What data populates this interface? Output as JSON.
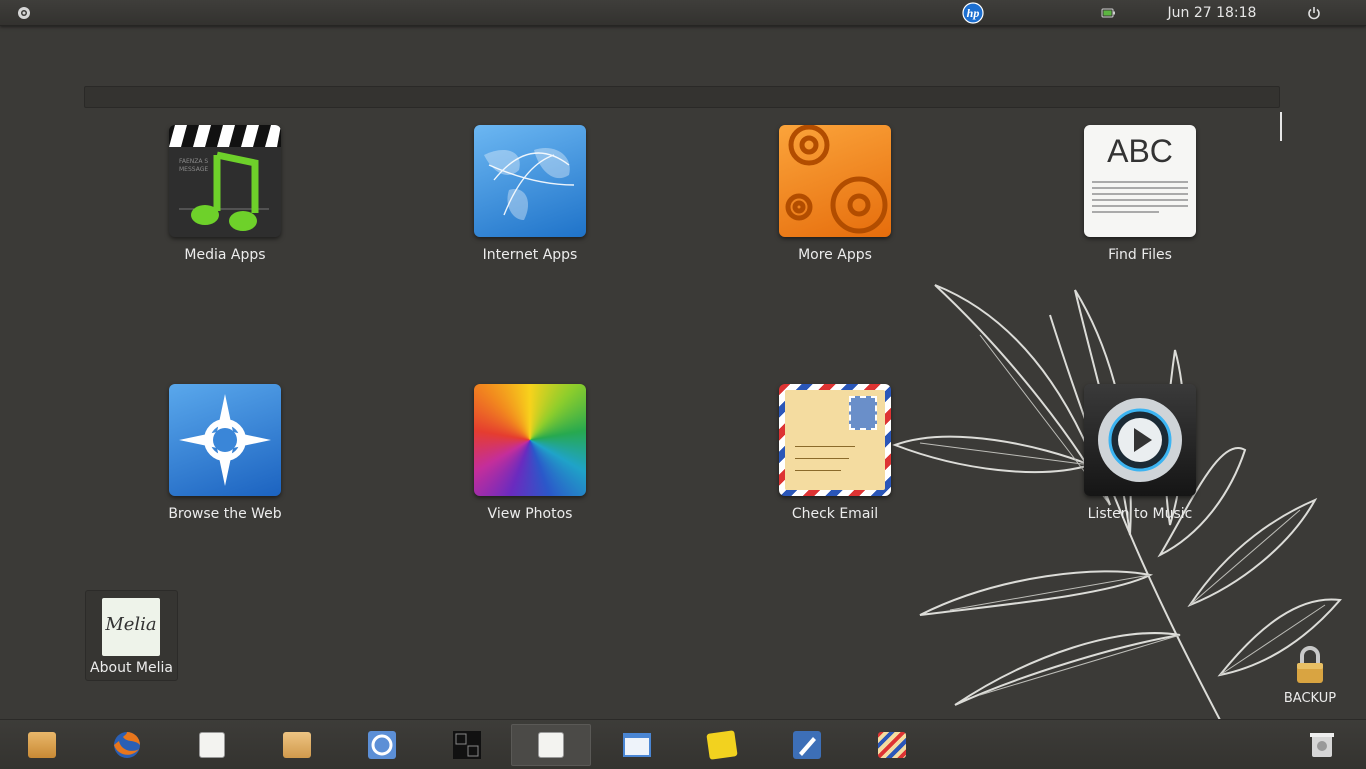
{
  "topbar": {
    "clock": "Jun 27 18:18",
    "icons": [
      "ubuntu-menu-icon",
      "hp-logo",
      "battery-icon",
      "power-icon"
    ]
  },
  "search": {
    "value": "",
    "placeholder": ""
  },
  "apps": [
    {
      "label": "Media Apps",
      "icon": "media-apps-icon"
    },
    {
      "label": "Internet Apps",
      "icon": "internet-apps-icon"
    },
    {
      "label": "More Apps",
      "icon": "more-apps-icon"
    },
    {
      "label": "Find Files",
      "icon": "find-files-icon"
    },
    {
      "label": "Browse the Web",
      "icon": "browse-web-icon"
    },
    {
      "label": "View Photos",
      "icon": "view-photos-icon"
    },
    {
      "label": "Check Email",
      "icon": "check-email-icon"
    },
    {
      "label": "Listen to Music",
      "icon": "listen-music-icon"
    }
  ],
  "find_files_icon_text": "ABC",
  "about": {
    "label": "About Melia",
    "icon_text": "Melia"
  },
  "backup": {
    "label": "BACKUP"
  },
  "dock": [
    "home-folder-icon",
    "firefox-icon",
    "text-editor-icon",
    "files-folder-icon",
    "chromium-icon",
    "terminal-icon",
    "notepad-icon",
    "window-icon",
    "sticky-notes-icon",
    "writer-icon",
    "mail-icon",
    "trash-icon"
  ],
  "colors": {
    "background": "#3b3a37",
    "panel": "#3a3936",
    "text": "#ececec"
  }
}
